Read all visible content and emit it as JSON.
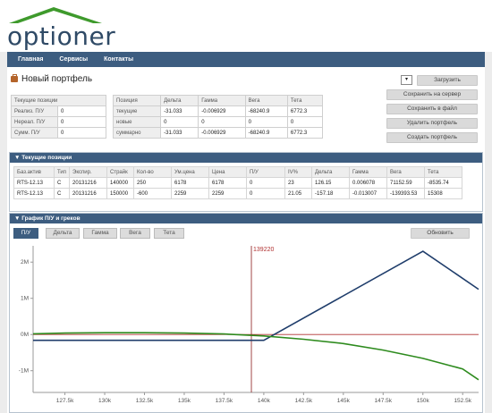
{
  "brand": {
    "logo_text": "optioner"
  },
  "nav": {
    "items": [
      "Главная",
      "Сервисы",
      "Контакты"
    ]
  },
  "portfolio": {
    "title": "Новый портфель",
    "pnl": {
      "header": "Текущие позиции",
      "rows": [
        {
          "label": "Реализ. П/У",
          "value": "0"
        },
        {
          "label": "Нереал. П/У",
          "value": "0"
        },
        {
          "label": "Сумм. П/У",
          "value": "0"
        }
      ]
    },
    "greeks": {
      "headers": [
        "Позиция",
        "Дельта",
        "Гамма",
        "Вега",
        "Тета"
      ],
      "rows": [
        [
          "текущие",
          "-31.033",
          "-0.006929",
          "-68240.9",
          "6772.3"
        ],
        [
          "новые",
          "0",
          "0",
          "0",
          "0"
        ],
        [
          "суммарно",
          "-31.033",
          "-0.006929",
          "-68240.9",
          "6772.3"
        ]
      ]
    }
  },
  "actions": {
    "select_value": "▾",
    "load": "Загрузить",
    "save_server": "Сохранить на сервер",
    "save_file": "Сохранить в файл",
    "delete": "Удалить портфель",
    "create": "Создать портфель"
  },
  "positions": {
    "title": "▼ Текущие позиции",
    "headers": [
      "Баз.актив",
      "Тип",
      "Экспир.",
      "Страйк",
      "Кол-во",
      "Ум.цена",
      "Цена",
      "П/У",
      "IV%",
      "Дельта",
      "Гамма",
      "Вега",
      "Тета"
    ],
    "rows": [
      [
        "RTS-12.13",
        "C",
        "20131216",
        "140000",
        "250",
        "6178",
        "6178",
        "0",
        "23",
        "126.15",
        "0.006078",
        "71152.59",
        "-8535.74"
      ],
      [
        "RTS-12.13",
        "C",
        "20131216",
        "150000",
        "-600",
        "2259",
        "2259",
        "0",
        "21.05",
        "-157.18",
        "-0.013007",
        "-139393.53",
        "15308"
      ]
    ]
  },
  "chart_panel": {
    "title": "▼ График П/У и греков",
    "tabs": [
      "П/У",
      "Дельта",
      "Гамма",
      "Вега",
      "Тета"
    ],
    "active_tab": "П/У",
    "refresh": "Обновить"
  },
  "chart_data": {
    "type": "line",
    "x_ticks": [
      "127.5k",
      "130k",
      "132.5k",
      "135k",
      "137.5k",
      "140k",
      "142.5k",
      "145k",
      "147.5k",
      "150k",
      "152.5k"
    ],
    "y_ticks": [
      "2M",
      "1M",
      "0M",
      "-1M"
    ],
    "xlim": [
      125500,
      153500
    ],
    "ylim": [
      -1600000,
      2450000
    ],
    "vline": {
      "x": 139220,
      "label": "139220"
    },
    "series": [
      {
        "color": "#1f3d6b",
        "x": [
          125500,
          130000,
          135000,
          139220,
          140000,
          150000,
          153500
        ],
        "y": [
          -160000,
          -160000,
          -160000,
          -160000,
          -160000,
          2300000,
          1250000
        ]
      },
      {
        "color": "#2e8b1e",
        "x": [
          125500,
          127500,
          130000,
          132500,
          135000,
          137500,
          140000,
          142500,
          145000,
          147500,
          150000,
          152500,
          153500
        ],
        "y": [
          20000,
          40000,
          50000,
          50000,
          40000,
          15000,
          -40000,
          -130000,
          -250000,
          -430000,
          -660000,
          -950000,
          -1250000
        ]
      }
    ],
    "zero_line_color": "#b03030"
  }
}
